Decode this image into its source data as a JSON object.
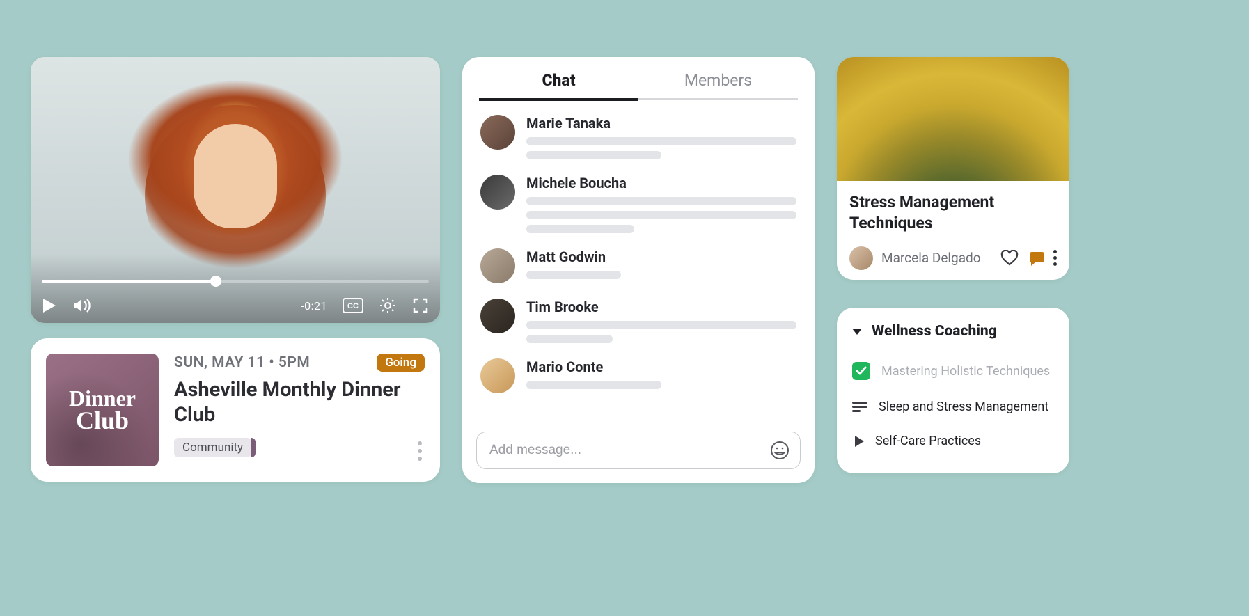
{
  "video": {
    "time_remaining": "-0:21"
  },
  "event": {
    "thumb_line1": "Dinner",
    "thumb_line2": "Club",
    "date": "SUN, MAY 11 • 5PM",
    "status": "Going",
    "title": "Asheville Monthly Dinner Club",
    "tag": "Community"
  },
  "chat": {
    "tabs": {
      "chat": "Chat",
      "members": "Members"
    },
    "messages": [
      {
        "name": "Marie Tanaka",
        "lines": [
          100,
          50
        ]
      },
      {
        "name": "Michele Boucha",
        "lines": [
          100,
          100,
          40
        ]
      },
      {
        "name": "Matt Godwin",
        "lines": [
          35
        ]
      },
      {
        "name": "Tim Brooke",
        "lines": [
          100,
          32
        ]
      },
      {
        "name": "Mario Conte",
        "lines": [
          50
        ]
      }
    ],
    "input_placeholder": "Add message..."
  },
  "article": {
    "title": "Stress Management Techniques",
    "author": "Marcela Delgado"
  },
  "course": {
    "title": "Wellness Coaching",
    "items": [
      {
        "label": "Mastering Holistic Techniques",
        "type": "done"
      },
      {
        "label": "Sleep and Stress Management",
        "type": "text"
      },
      {
        "label": "Self-Care Practices",
        "type": "video"
      }
    ]
  }
}
